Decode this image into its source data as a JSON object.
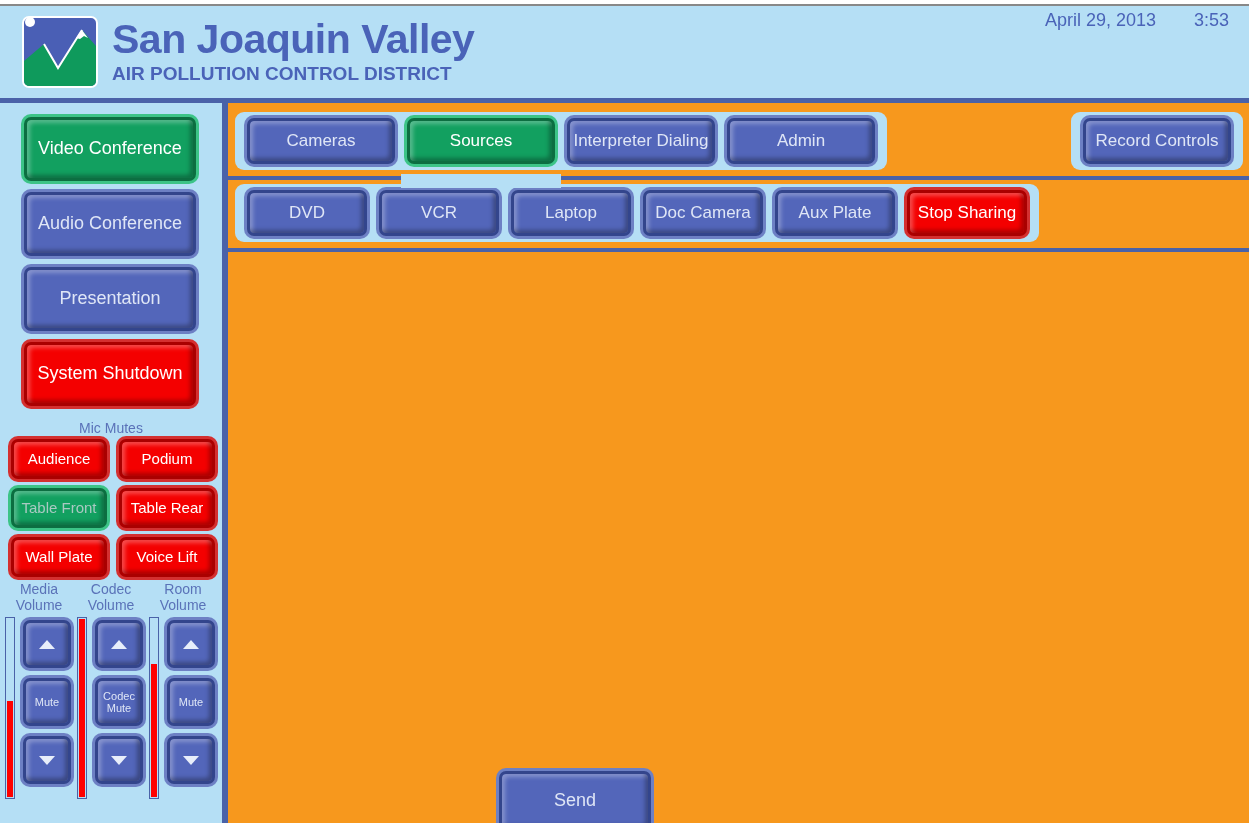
{
  "header": {
    "title": "San Joaquin Valley",
    "subtitle": "AIR POLLUTION CONTROL DISTRICT",
    "date": "April 29, 2013",
    "time": "3:53"
  },
  "modes": [
    {
      "label": "Video Conference",
      "selected": true,
      "kind": "mode"
    },
    {
      "label": "Audio Conference",
      "selected": false,
      "kind": "mode"
    },
    {
      "label": "Presentation",
      "selected": false,
      "kind": "mode"
    },
    {
      "label": "System Shutdown",
      "selected": false,
      "kind": "danger"
    }
  ],
  "mic_mutes": {
    "title": "Mic Mutes",
    "mics": [
      {
        "label": "Audience",
        "muted": true
      },
      {
        "label": "Podium",
        "muted": true
      },
      {
        "label": "Table Front",
        "muted": false
      },
      {
        "label": "Table Rear",
        "muted": true
      },
      {
        "label": "Wall Plate",
        "muted": true
      },
      {
        "label": "Voice Lift",
        "muted": true
      }
    ]
  },
  "volumes": [
    {
      "label": "Media Volume",
      "mute_label": "Mute",
      "level": 0.54
    },
    {
      "label": "Codec Volume",
      "mute_label": "Codec Mute",
      "level": 1.0
    },
    {
      "label": "Room Volume",
      "mute_label": "Mute",
      "level": 0.75
    }
  ],
  "tabs": [
    {
      "label": "Cameras",
      "selected": false
    },
    {
      "label": "Sources",
      "selected": true
    },
    {
      "label": "Interpreter Dialing",
      "selected": false
    },
    {
      "label": "Admin",
      "selected": false
    }
  ],
  "record_button": "Record Controls",
  "sources": [
    {
      "label": "DVD",
      "kind": "source"
    },
    {
      "label": "VCR",
      "kind": "source"
    },
    {
      "label": "Laptop",
      "kind": "source"
    },
    {
      "label": "Doc Camera",
      "kind": "source"
    },
    {
      "label": "Aux Plate",
      "kind": "source"
    },
    {
      "label": "Stop Sharing",
      "kind": "stop"
    }
  ],
  "send_button": "Send"
}
